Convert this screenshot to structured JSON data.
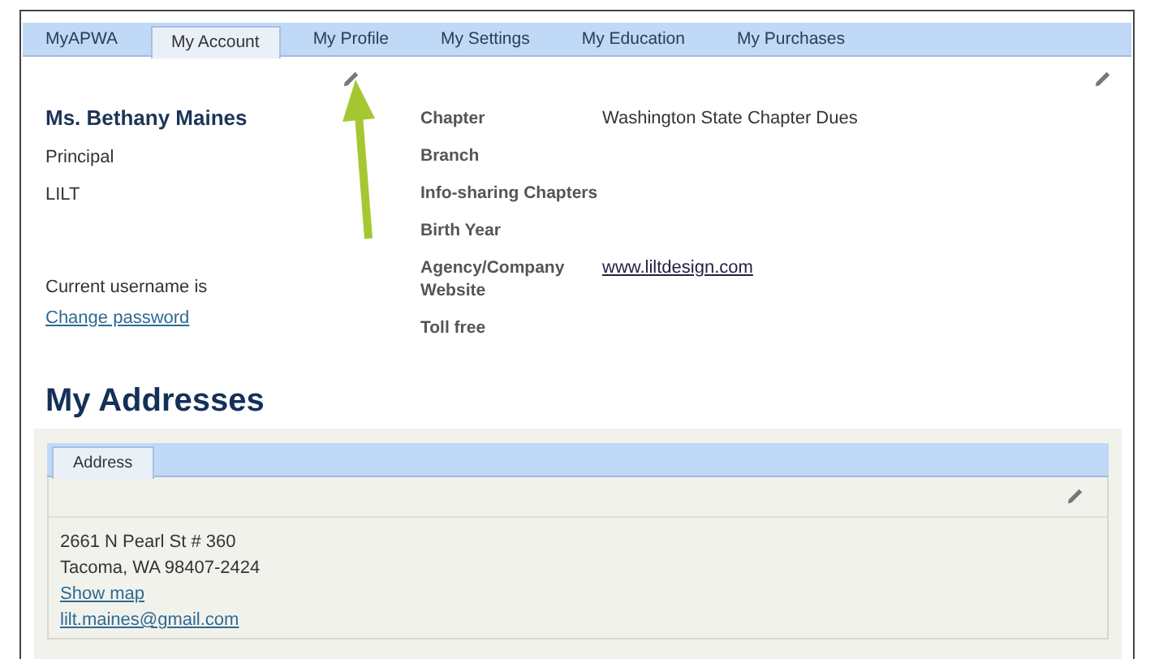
{
  "tabs": [
    {
      "label": "MyAPWA",
      "selected": false
    },
    {
      "label": "My Account",
      "selected": true
    },
    {
      "label": "My Profile",
      "selected": false
    },
    {
      "label": "My Settings",
      "selected": false
    },
    {
      "label": "My Education",
      "selected": false
    },
    {
      "label": "My Purchases",
      "selected": false
    }
  ],
  "account": {
    "name": "Ms. Bethany Maines",
    "lines": [
      "Principal",
      "LILT"
    ],
    "username_label": "Current username is",
    "change_password": "Change password",
    "fields": [
      {
        "label": "Chapter",
        "value": "Washington State Chapter Dues",
        "kind": "text"
      },
      {
        "label": "Branch"
      },
      {
        "label": "Info-sharing Chapters"
      },
      {
        "label": "Birth Year"
      },
      {
        "label": "Agency/Company Website",
        "value": "www.liltdesign.com",
        "kind": "link"
      },
      {
        "label": "Toll free"
      }
    ]
  },
  "addresses": {
    "title": "My Addresses",
    "tabs": [
      {
        "label": "Address",
        "selected": true
      }
    ],
    "lines": [
      "2661 N Pearl St # 360",
      "Tacoma, WA 98407-2424"
    ],
    "show_map": "Show map",
    "email": "lilt.maines@gmail.com"
  }
}
